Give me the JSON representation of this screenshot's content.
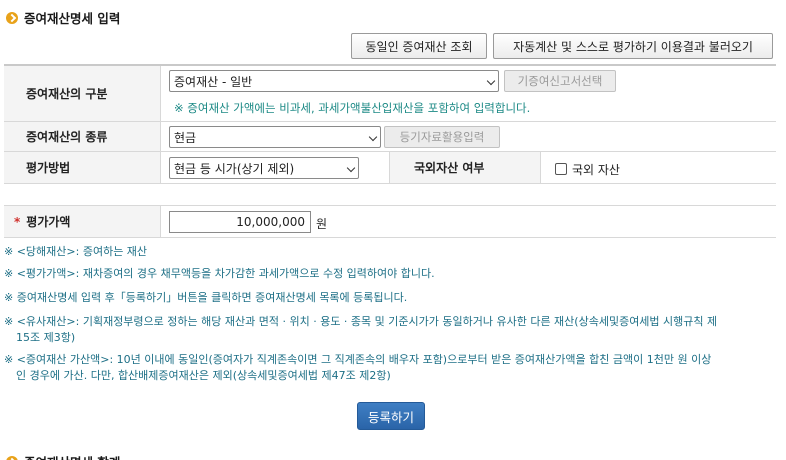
{
  "section_title": "증여재산명세 입력",
  "buttons": {
    "same_person": "동일인 증여재산 조회",
    "auto_calc": "자동계산 및 스스로 평가하기 이용결과 불러오기",
    "register": "등록하기"
  },
  "rows": {
    "category": {
      "label": "증여재산의 구분",
      "select_value": "증여재산 - 일반",
      "side_button": "기증여신고서선택",
      "note": "※ 증여재산 가액에는 비과세, 과세가액불산입재산을 포함하여 입력합니다."
    },
    "type": {
      "label": "증여재산의 종류",
      "select_value": "현금",
      "side_button": "등기자료활용입력"
    },
    "method": {
      "label": "평가방법",
      "select_value": "현금 등 시가(상기 제외)",
      "foreign_label": "국외자산 여부",
      "foreign_checkbox_label": "국외 자산",
      "foreign_checked": false
    },
    "amount": {
      "required_mark": "*",
      "label": "평가가액",
      "value": "10,000,000",
      "unit": "원"
    }
  },
  "notes": [
    "※ <당해재산>: 증여하는 재산",
    "※ <평가가액>: 재차증여의 경우 채무액등을 차가감한 과세가액으로 수정 입력하여야 합니다.",
    "※ 증여재산명세 입력 후「등록하기」버튼을 클릭하면 증여재산명세 목록에 등록됩니다.",
    "※ <유사재산>: 기획재정부령으로 정하는 해당 재산과 면적 · 위치 · 용도 · 종목 및 기준시가가 동일하거나 유사한 다른 재산(상속세및증여세법 시행규칙 제",
    "15조 제3항)",
    "※ <증여재산 가산액>: 10년 이내에 동일인(증여자가 직계존속이면 그 직계존속의 배우자 포함)으로부터 받은 증여재산가액을 합친 금액이 1천만 원 이상",
    "인 경우에 가산. 다만, 합산배제증여재산은 제외(상속세및증여세법 제47조 제2항)"
  ],
  "next_section_title": "증여재산명세 합계"
}
